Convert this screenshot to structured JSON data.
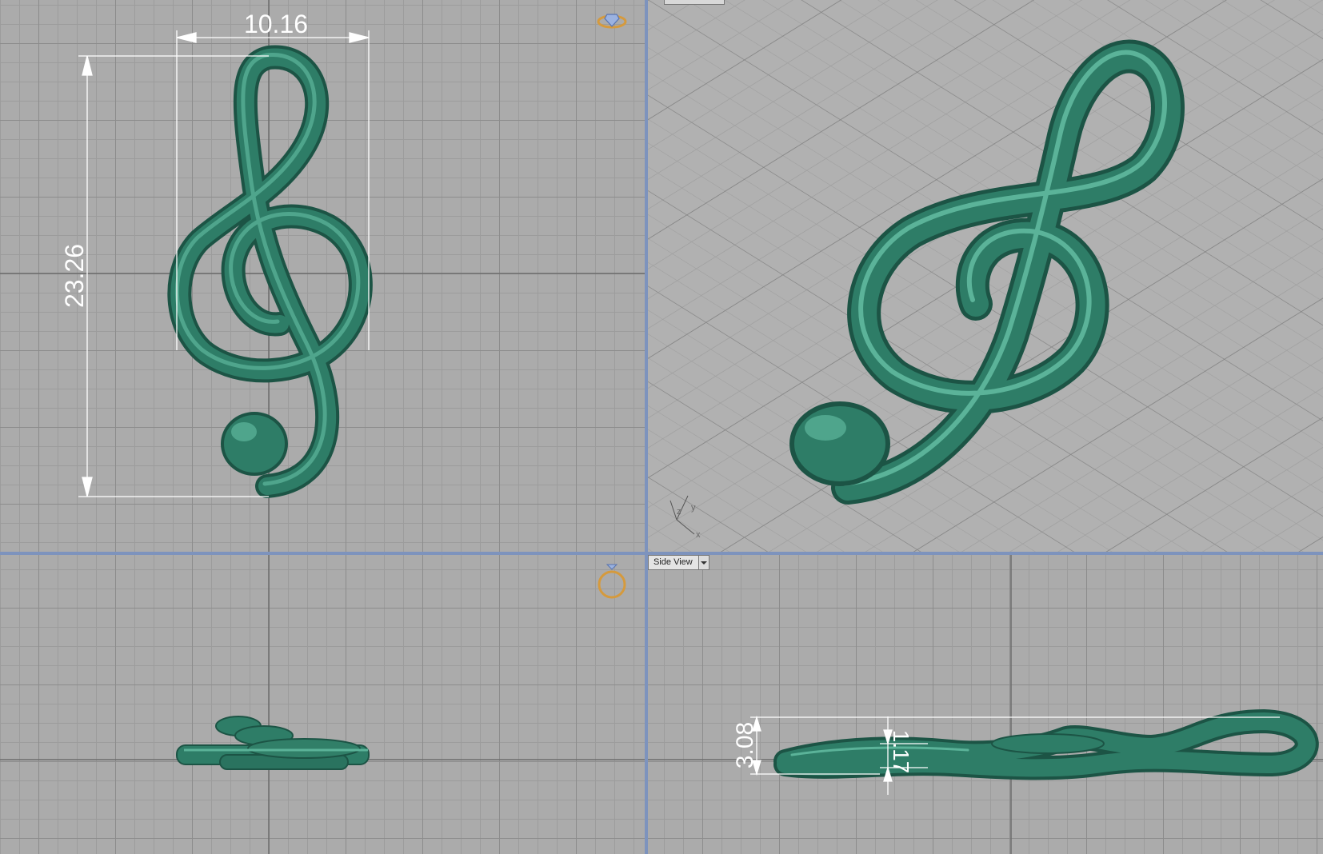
{
  "viewports": {
    "top": {
      "dimension_width": "10.16",
      "dimension_height": "23.26"
    },
    "perspective": {
      "axis_labels": {
        "z": "z",
        "y": "y",
        "x": "x"
      }
    },
    "front": {},
    "side": {
      "title": "Side View",
      "dimension_height": "3.08",
      "dimension_thickness": "1.17"
    }
  },
  "colors": {
    "model": "#2e7d67",
    "dimension": "#ffffff",
    "divider": "#7d93bd"
  },
  "icons": [
    "ring-top-icon",
    "ring-side-icon",
    "viewport-dropdown-icon",
    "axis-triad-icon"
  ]
}
